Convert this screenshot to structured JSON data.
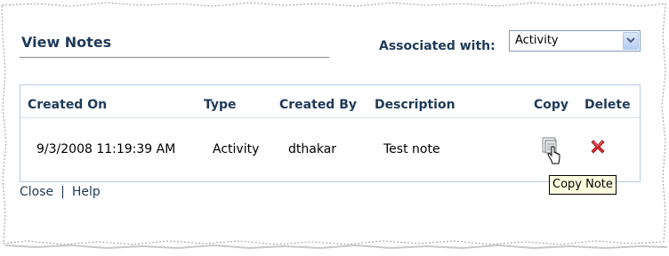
{
  "panel": {
    "title": "View Notes",
    "associated_label": "Associated with:",
    "associated_value": "Activity"
  },
  "table": {
    "headers": {
      "created_on": "Created On",
      "type": "Type",
      "created_by": "Created By",
      "description": "Description",
      "copy": "Copy",
      "delete": "Delete"
    },
    "rows": [
      {
        "created_on": "9/3/2008 11:19:39 AM",
        "type": "Activity",
        "created_by": "dthakar",
        "description": "Test note"
      }
    ]
  },
  "tooltip": "Copy Note",
  "footer": {
    "close": "Close",
    "separator": "|",
    "help": "Help"
  },
  "icons": {
    "copy": "copy-note-icon",
    "delete": "delete-x-icon",
    "dropdown": "chevron-down-icon",
    "cursor": "hand-pointer-icon"
  },
  "colors": {
    "heading": "#1f3a5a",
    "delete_red": "#d8262b",
    "tooltip_bg": "#ffffe1"
  }
}
